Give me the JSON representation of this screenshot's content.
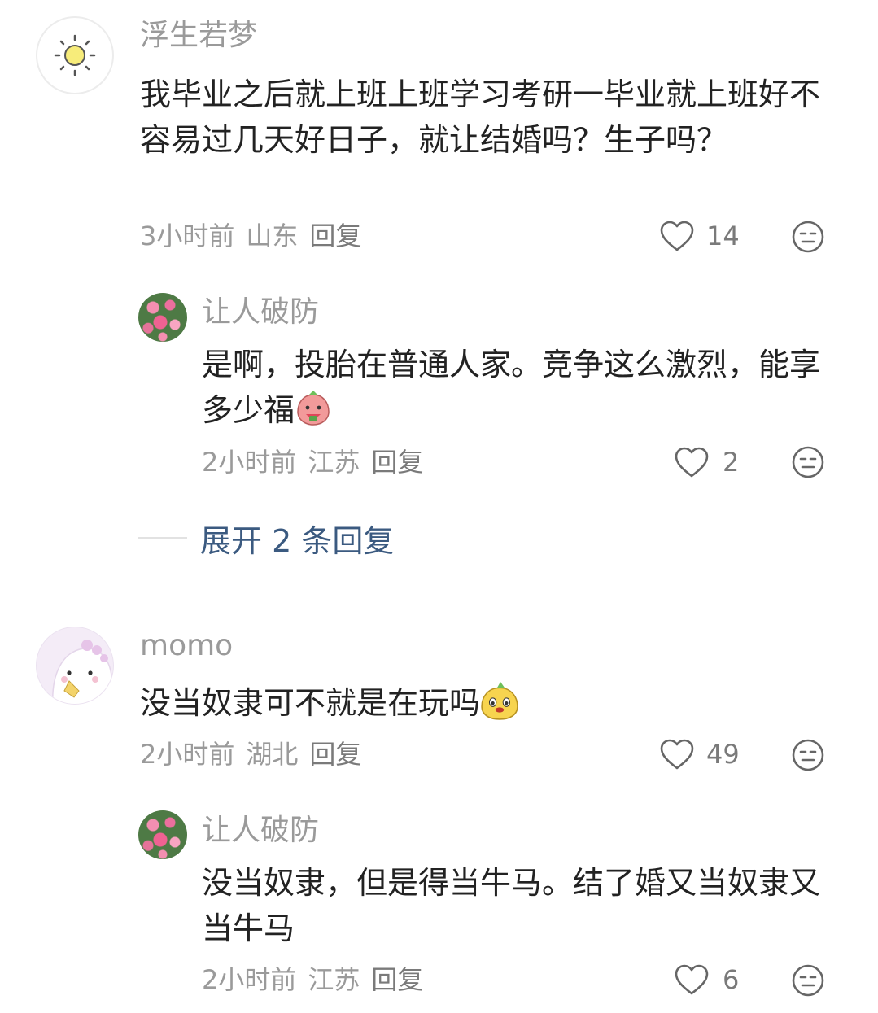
{
  "comments": [
    {
      "author": "浮生若梦",
      "text": "我毕业之后就上班上班学习考研一毕业就上班好不容易过几天好日子，就让结婚吗？生子吗？",
      "time": "3小时前",
      "location": "山东",
      "reply_label": "回复",
      "likes": "14",
      "avatar_icon": "sun-icon",
      "replies": [
        {
          "author": "让人破防",
          "text": "是啊，投胎在普通人家。竞争这么激烈，能享多少福",
          "emoji": "strawberry-sticker-emoji",
          "time": "2小时前",
          "location": "江苏",
          "reply_label": "回复",
          "likes": "2",
          "avatar_icon": "rose-avatar"
        }
      ],
      "expand_label": "展开 2 条回复"
    },
    {
      "author": "momo",
      "text": "没当奴隶可不就是在玩吗",
      "emoji": "yellow-blob-sticker-emoji",
      "time": "2小时前",
      "location": "湖北",
      "reply_label": "回复",
      "likes": "49",
      "avatar_icon": "dino-avatar",
      "replies": [
        {
          "author": "让人破防",
          "text": "没当奴隶，但是得当牛马。结了婚又当奴隶又当牛马",
          "time": "2小时前",
          "location": "江苏",
          "reply_label": "回复",
          "likes": "6",
          "avatar_icon": "rose-avatar"
        }
      ]
    }
  ],
  "colors": {
    "secondary_text": "#9a9a9a",
    "main_text": "#222222",
    "expand_link": "#3b5a80"
  }
}
